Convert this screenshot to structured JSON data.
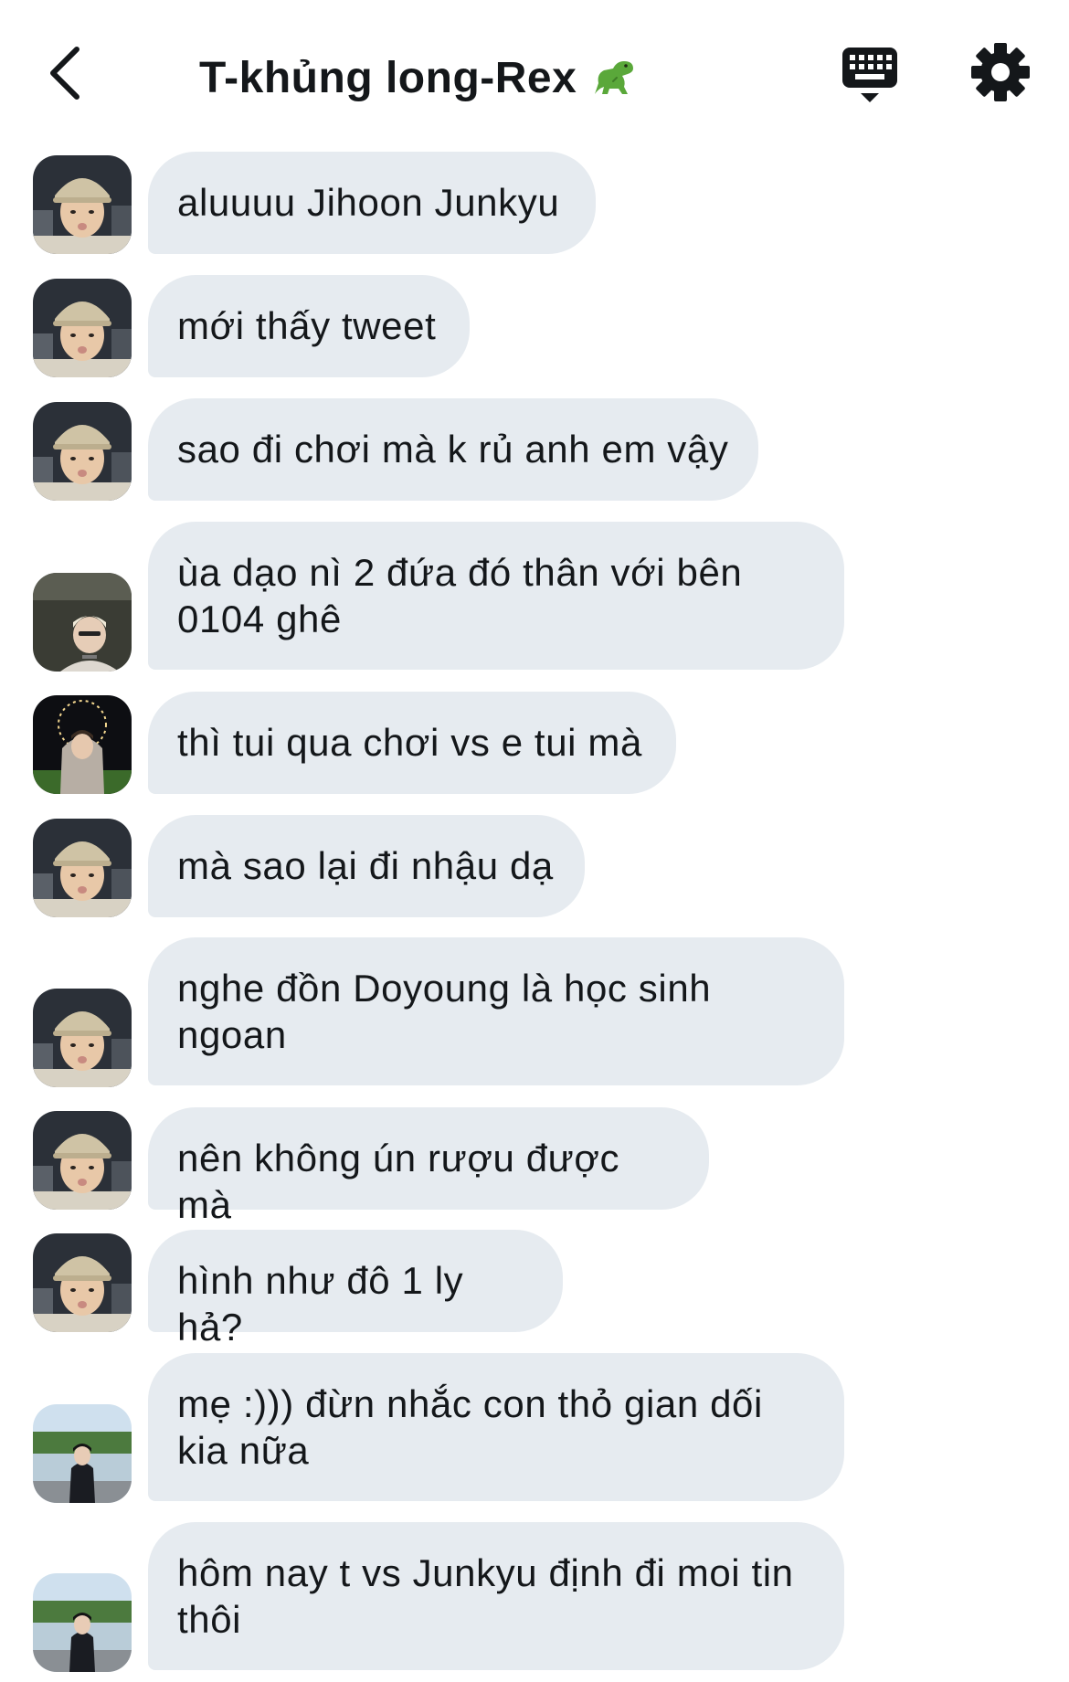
{
  "header": {
    "title": "T-khủng long-Rex",
    "title_emoji": "🦖",
    "back_icon": "chevron-left-icon",
    "keyboard_icon": "keyboard-icon",
    "settings_icon": "gear-icon"
  },
  "colors": {
    "bubble": "#e6ebf0",
    "text": "#14171a"
  },
  "messages": [
    {
      "text": "aluuuu Jihoon Junkyu",
      "avatar": "cap-boy"
    },
    {
      "text": "mới thấy tweet",
      "avatar": "cap-boy"
    },
    {
      "text": "sao đi chơi mà k rủ anh em vậy",
      "avatar": "cap-boy"
    },
    {
      "text": "ùa dạo nì 2 đứa đó thân với bên 0104 ghê",
      "avatar": "blonde-boy"
    },
    {
      "text": "thì tui qua chơi vs e tui mà",
      "avatar": "hoodie-boy"
    },
    {
      "text": "mà sao lại đi nhậu dạ",
      "avatar": "cap-boy"
    },
    {
      "text": "nghe đồn Doyoung là học sinh ngoan",
      "avatar": "cap-boy"
    },
    {
      "text": "nên không ún rượu được mà",
      "avatar": "cap-boy"
    },
    {
      "text": "hình như đô 1 ly hả?",
      "avatar": "cap-boy"
    },
    {
      "text": "mẹ :))) đừn nhắc con thỏ gian dối kia nữa",
      "avatar": "lake-boy"
    },
    {
      "text": "hôm nay t vs Junkyu định đi moi tin thôi",
      "avatar": "lake-boy"
    }
  ]
}
